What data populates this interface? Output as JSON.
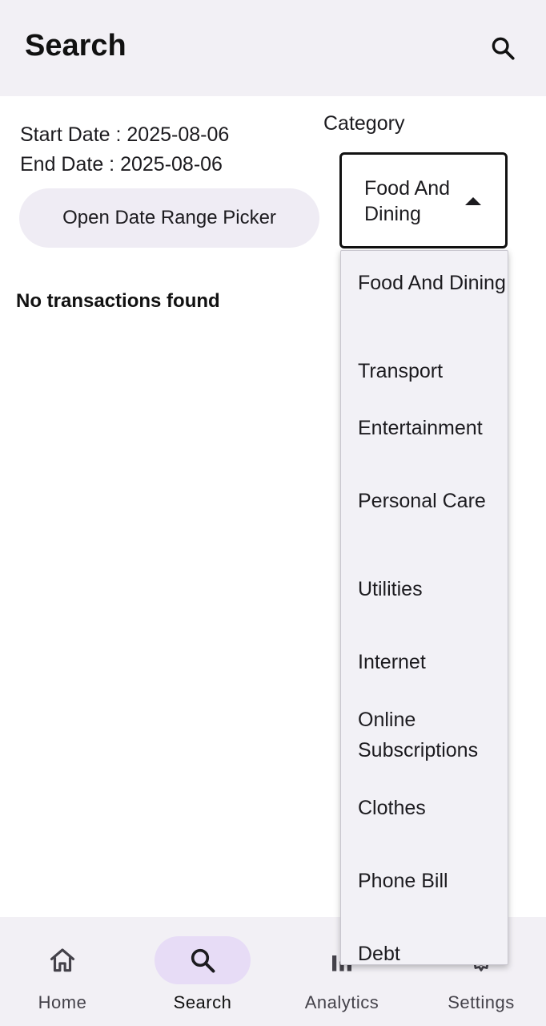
{
  "header": {
    "title": "Search",
    "search_icon": "search-icon"
  },
  "filters": {
    "start_date_text": "Start Date : 2025-08-06",
    "end_date_text": "End Date : 2025-08-06",
    "date_range_button": "Open Date Range Picker"
  },
  "results": {
    "empty_message": "No transactions found"
  },
  "category": {
    "label": "Category",
    "selected_value": "Food And Dining",
    "expanded": true,
    "options": [
      "Food And Dining",
      "Transport",
      "Entertainment",
      "Personal Care",
      "Utilities",
      "Internet",
      "Online Subscriptions",
      "Clothes",
      "Phone Bill",
      "Debt"
    ]
  },
  "bottom_nav": {
    "items": [
      {
        "label": "Home",
        "icon": "home-icon",
        "active": false
      },
      {
        "label": "Search",
        "icon": "search-icon",
        "active": true
      },
      {
        "label": "Analytics",
        "icon": "analytics-icon",
        "active": false
      },
      {
        "label": "Settings",
        "icon": "settings-icon",
        "active": false
      }
    ]
  },
  "colors": {
    "app_bar_bg": "#f2f0f5",
    "active_nav_pill": "#e7dcf6",
    "date_button_bg": "#efecf4",
    "dropdown_bg": "#f2f1f6"
  }
}
